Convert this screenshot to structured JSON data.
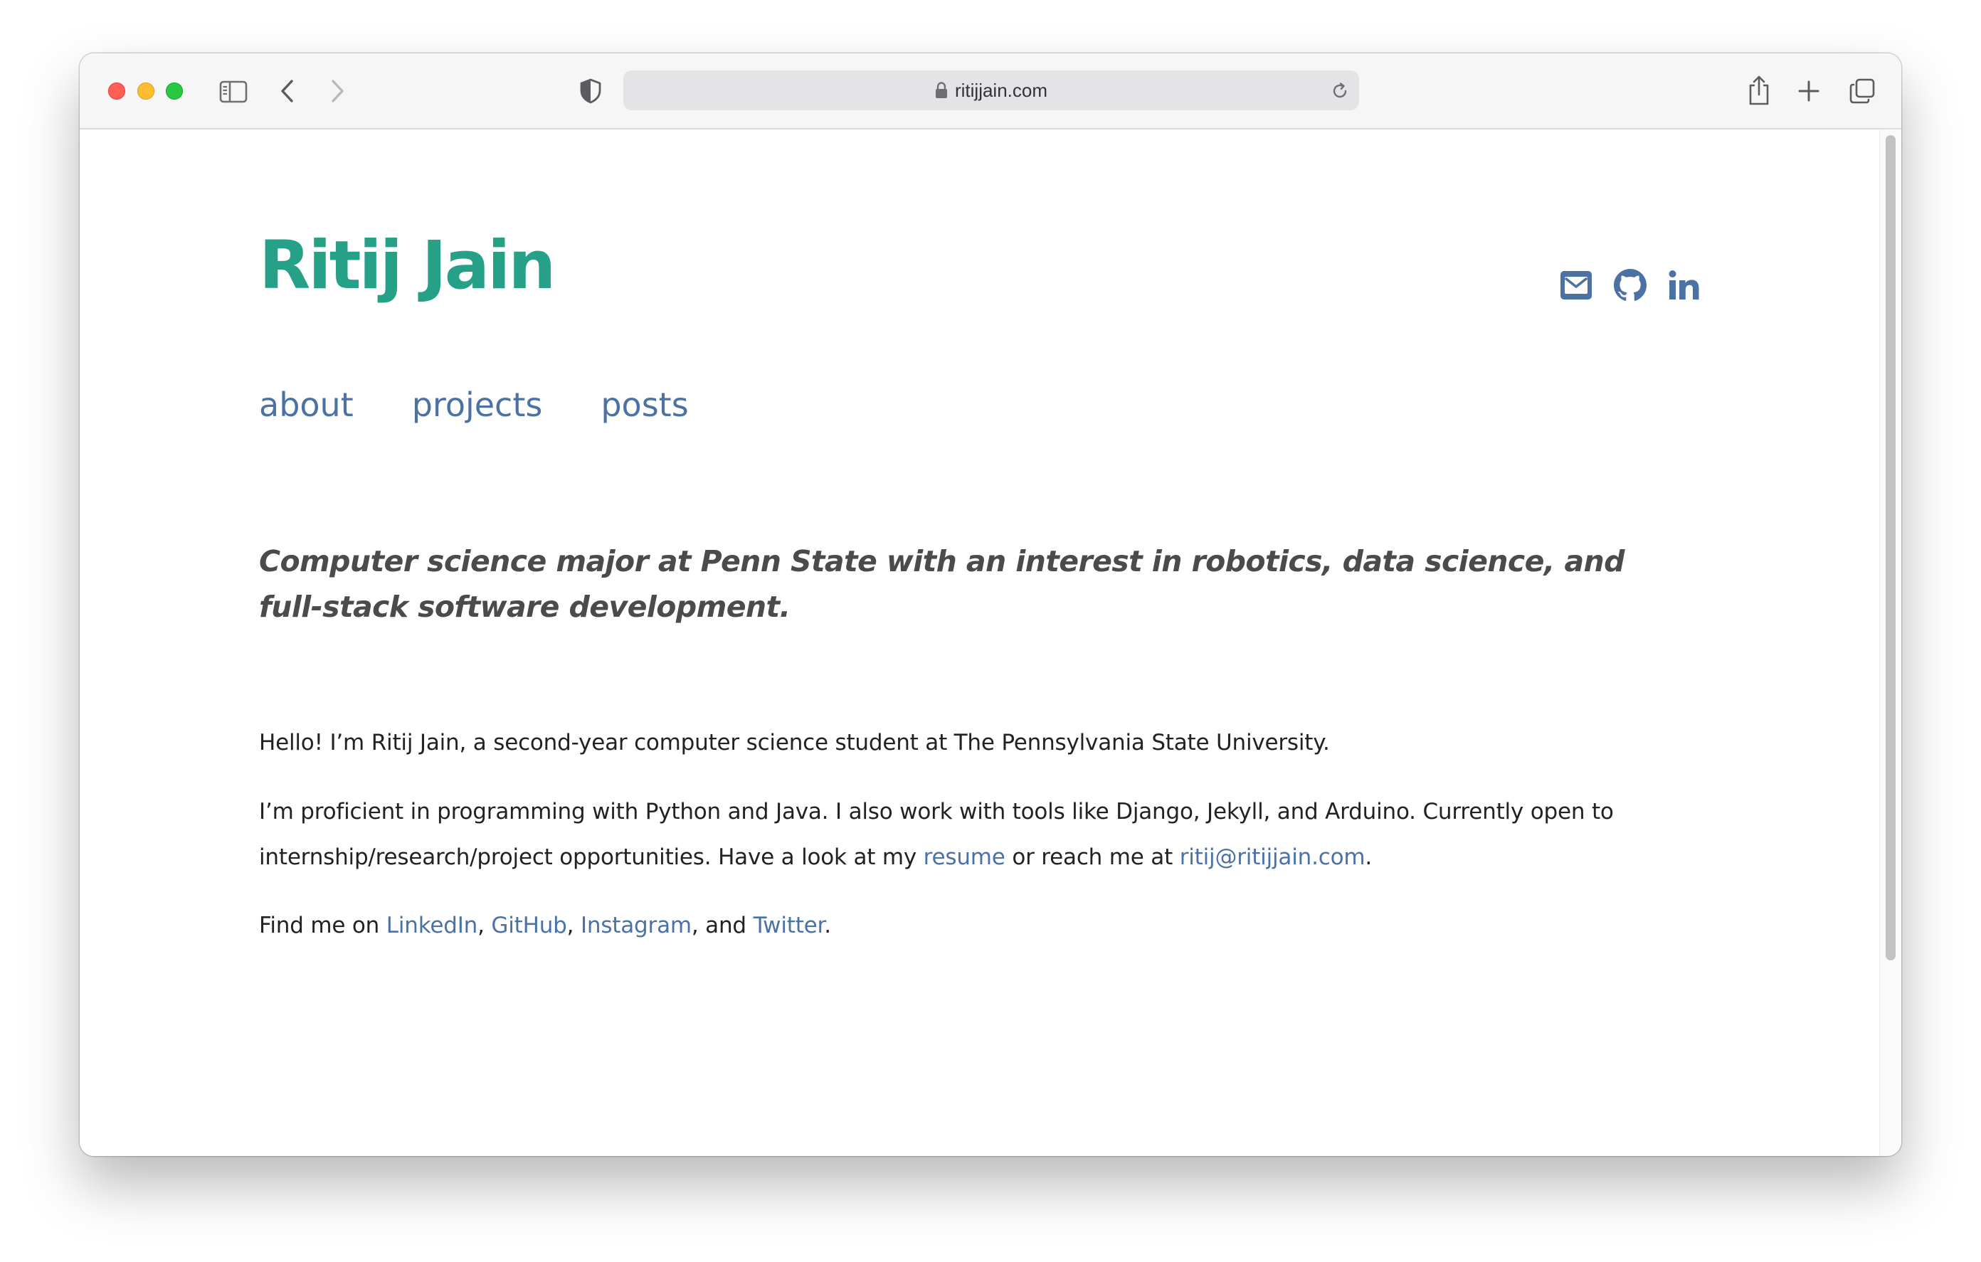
{
  "browser": {
    "url": "ritijjain.com",
    "icons": [
      "sidebar-icon",
      "back-icon",
      "forward-icon",
      "shield-icon",
      "lock-icon",
      "reload-icon",
      "share-icon",
      "new-tab-icon",
      "tab-overview-icon"
    ]
  },
  "site": {
    "title": "Ritij Jain",
    "nav": [
      "about",
      "projects",
      "posts"
    ],
    "social_icons": [
      "envelope-icon",
      "github-icon",
      "linkedin-icon"
    ],
    "tagline": "Computer science major at Penn State with an interest in robotics, data science, and full-stack software development.",
    "intro": "Hello! I’m Ritij Jain, a second-year computer science student at The Pennsylvania State University.",
    "skills_text": "I’m proficient in programming with Python and Java. I also work with tools like Django, Jekyll, and Arduino. Currently open to internship/research/project opportunities. Have a look at my",
    "resume_link": "resume",
    "reach_text": "or reach me at",
    "email_link": "ritij@ritijjain.com",
    "period": ".",
    "find_text": "Find me on",
    "links": [
      "LinkedIn",
      "GitHub",
      "Instagram",
      "Twitter"
    ],
    "comma": ",",
    "and_text": ", and"
  },
  "colors": {
    "title": "#26a087",
    "link": "#4c72a4",
    "tagline": "#4b4b4e",
    "body": "#222222"
  }
}
